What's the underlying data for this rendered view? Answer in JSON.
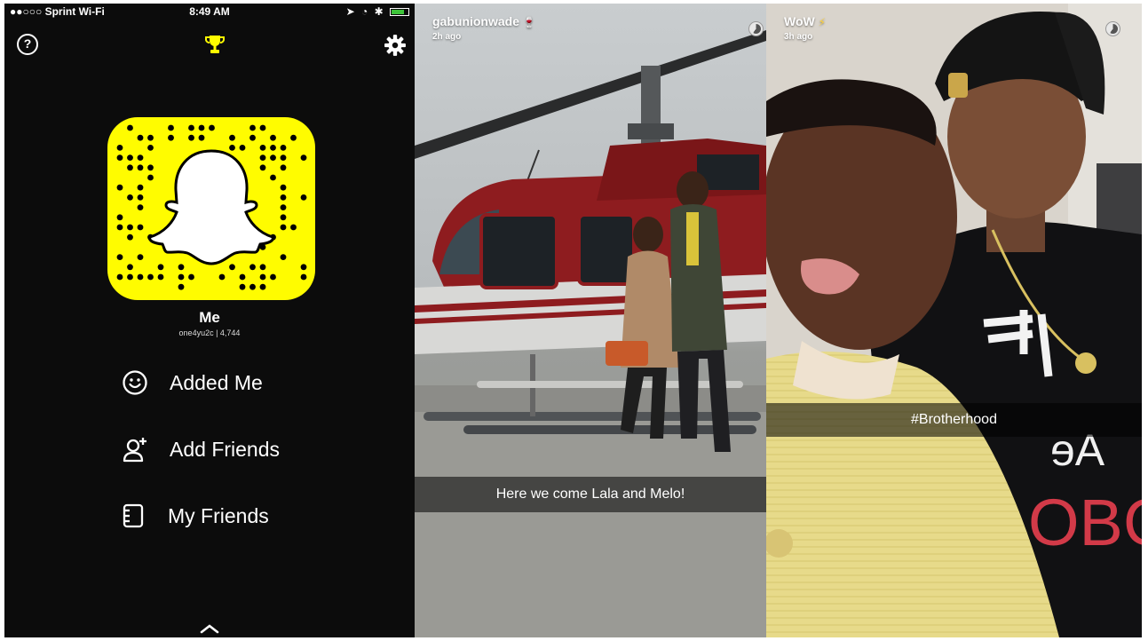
{
  "status_bar": {
    "carrier": "●●○○○ Sprint Wi-Fi",
    "time": "8:49 AM"
  },
  "profile": {
    "name": "Me",
    "username_score": "one4yu2c | 4,744",
    "menu": [
      {
        "label": "Added Me",
        "icon": "smiley-icon"
      },
      {
        "label": "Add Friends",
        "icon": "add-friend-icon"
      },
      {
        "label": "My Friends",
        "icon": "address-book-icon"
      }
    ]
  },
  "stories": [
    {
      "username": "gabunionwade",
      "time_ago": "2h ago",
      "caption": "Here we come Lala and Melo!"
    },
    {
      "username": "WoW",
      "time_ago": "3h ago",
      "caption": "#Brotherhood"
    }
  ],
  "colors": {
    "snap_yellow": "#fffc00",
    "profile_bg": "#0c0c0c",
    "helicopter_red": "#8e1c1f"
  }
}
